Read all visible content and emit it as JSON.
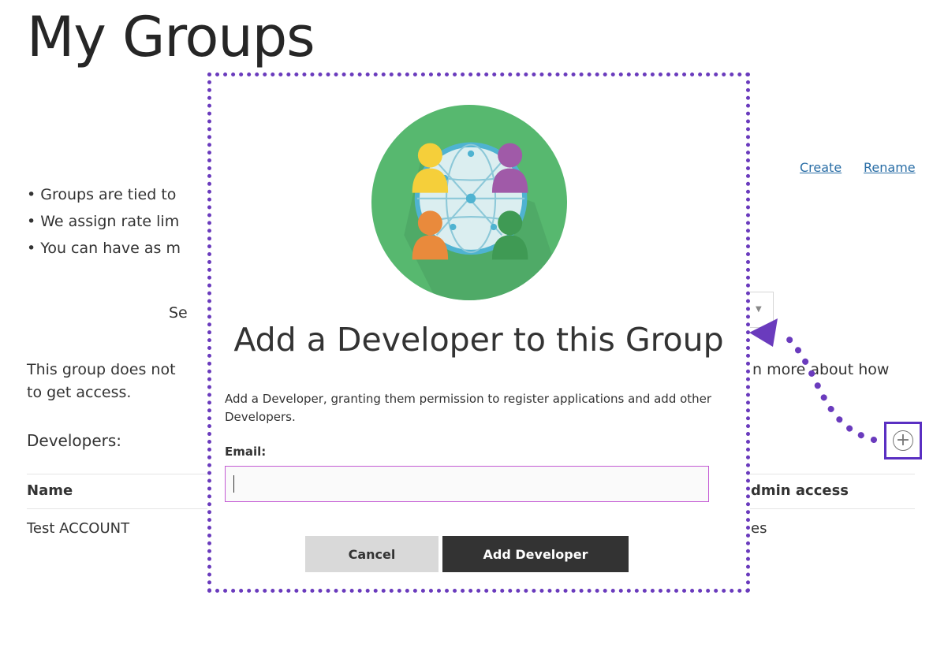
{
  "page": {
    "title": "My Groups",
    "links": {
      "create": "Create",
      "rename": "Rename"
    },
    "bullets": [
      "• Groups are tied to",
      "• We assign rate lim",
      "• You can have as m"
    ],
    "select_partial": "Se",
    "notice_line1_left": "This group does not",
    "notice_line1_right": "n more about how",
    "notice_line2": "to get access.",
    "developers_label": "Developers:",
    "table": {
      "headers": {
        "name": "Name",
        "admin": "dmin access"
      },
      "rows": [
        {
          "name": "Test ACCOUNT",
          "admin": "es"
        }
      ]
    }
  },
  "modal": {
    "title": "Add a Developer to this Group",
    "description": "Add a Developer, granting them permission to register applications and add other Developers.",
    "email_label": "Email:",
    "email_value": "",
    "email_placeholder": "",
    "cancel_label": "Cancel",
    "add_label": "Add Developer"
  },
  "icons": {
    "add_button": "plus-circle-icon",
    "illustration": "group-network-icon"
  },
  "colors": {
    "accent_purple": "#6a3bbd",
    "link_blue": "#2a6ea6",
    "input_border": "#c35ad4",
    "button_dark": "#333333",
    "button_light": "#d9d9d9",
    "illustration_green": "#57b86f"
  }
}
